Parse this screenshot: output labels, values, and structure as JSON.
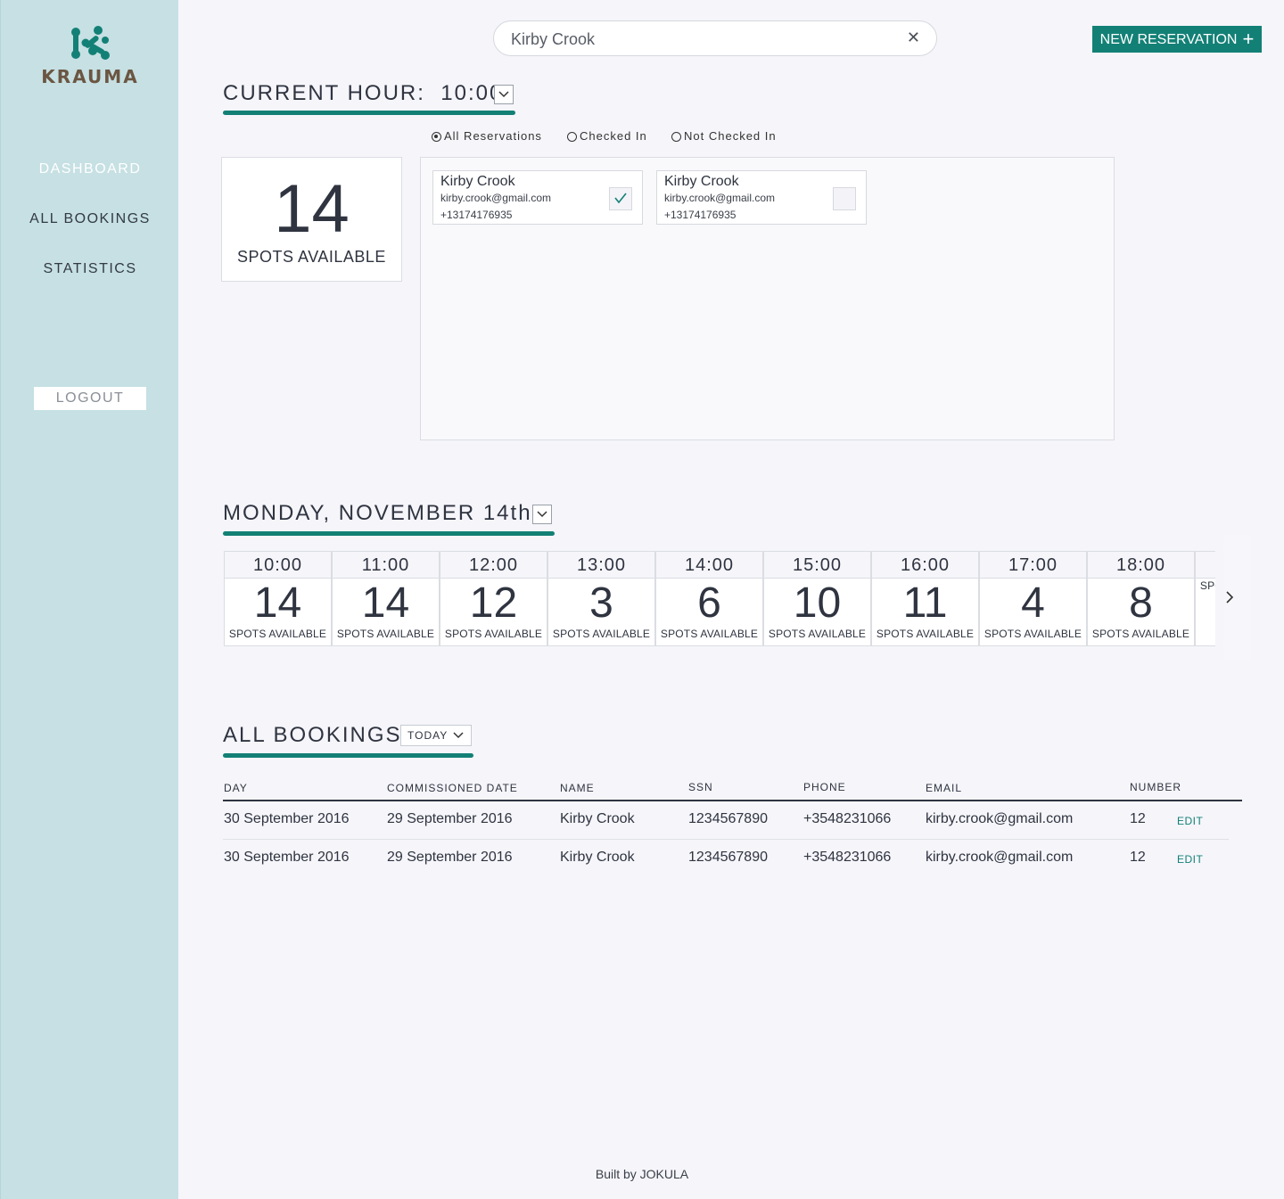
{
  "app": {
    "brand": "KRAUMA",
    "accent_color": "#138076",
    "sidebar_color": "#c6e0e3",
    "logo_color": "#138076",
    "brand_color": "#6b5642"
  },
  "sidebar": {
    "items": [
      {
        "label": "DASHBOARD",
        "active": true
      },
      {
        "label": "ALL BOOKINGS",
        "active": false
      },
      {
        "label": "STATISTICS",
        "active": false
      }
    ],
    "logout_label": "LOGOUT"
  },
  "search": {
    "value": "Kirby Crook",
    "clear_icon": "close-icon"
  },
  "new_reservation": {
    "label": "NEW RESERVATION",
    "icon": "+"
  },
  "current_hour": {
    "label": "CURRENT HOUR:",
    "time": "10:00",
    "spots": "14",
    "spots_label": "SPOTS AVAILABLE"
  },
  "filters": [
    {
      "label": "All Reservations",
      "selected": true
    },
    {
      "label": "Checked In",
      "selected": false
    },
    {
      "label": "Not Checked In",
      "selected": false
    }
  ],
  "reservations": [
    {
      "name": "Kirby Crook",
      "email": "kirby.crook@gmail.com",
      "phone": "+13174176935",
      "checked_in": true
    },
    {
      "name": "Kirby Crook",
      "email": "kirby.crook@gmail.com",
      "phone": "+13174176935",
      "checked_in": false
    }
  ],
  "day": {
    "title": "MONDAY, NOVEMBER 14th",
    "hours": [
      {
        "time": "10:00",
        "spots": "14",
        "label": "SPOTS AVAILABLE"
      },
      {
        "time": "11:00",
        "spots": "14",
        "label": "SPOTS AVAILABLE"
      },
      {
        "time": "12:00",
        "spots": "12",
        "label": "SPOTS AVAILABLE"
      },
      {
        "time": "13:00",
        "spots": "3",
        "label": "SPOTS AVAILABLE"
      },
      {
        "time": "14:00",
        "spots": "6",
        "label": "SPOTS AVAILABLE"
      },
      {
        "time": "15:00",
        "spots": "10",
        "label": "SPOTS AVAILABLE"
      },
      {
        "time": "16:00",
        "spots": "11",
        "label": "SPOTS AVAILABLE"
      },
      {
        "time": "17:00",
        "spots": "4",
        "label": "SPOTS AVAILABLE"
      },
      {
        "time": "18:00",
        "spots": "8",
        "label": "SPOTS AVAILABLE"
      },
      {
        "time": "",
        "spots": "",
        "label": "SPOTS AVAILABLE"
      }
    ]
  },
  "bookings": {
    "title": "ALL BOOKINGS",
    "filter_label": "TODAY",
    "columns": [
      "DAY",
      "COMMISSIONED DATE",
      "NAME",
      "SSN",
      "PHONE",
      "EMAIL",
      "NUMBER"
    ],
    "rows": [
      {
        "day": "30 September 2016",
        "commissioned": "29 September 2016",
        "name": "Kirby Crook",
        "ssn": "1234567890",
        "phone": "+3548231066",
        "email": "kirby.crook@gmail.com",
        "number": "12",
        "action": "EDIT"
      },
      {
        "day": "30 September 2016",
        "commissioned": "29 September 2016",
        "name": "Kirby Crook",
        "ssn": "1234567890",
        "phone": "+3548231066",
        "email": "kirby.crook@gmail.com",
        "number": "12",
        "action": "EDIT"
      }
    ]
  },
  "footer": {
    "text": "Built by JOKULA"
  }
}
